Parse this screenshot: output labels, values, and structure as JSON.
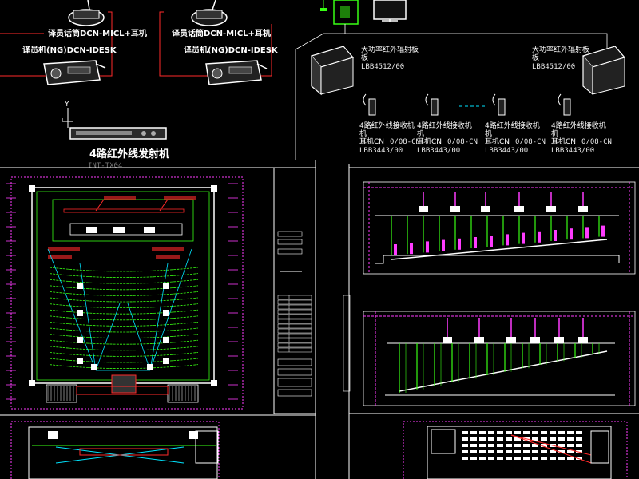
{
  "top_schematic": {
    "left_group": {
      "mic_label_1": "译员话筒DCN-MICL+耳机",
      "desk_label_1": "译员机(NG)DCN-IDESK",
      "transmitter_label": "4路红外线发射机",
      "transmitter_code": "INT-TX04",
      "antenna_label": "Y"
    },
    "right_group": {
      "mic_label_2": "译员话筒DCN-MICL+耳机",
      "desk_label_2": "译员机(NG)DCN-IDESK"
    },
    "radiators": [
      {
        "name": "大功率红外辐射板",
        "code": "LBB4512/00"
      },
      {
        "name": "大功率红外辐射板",
        "code": "LBB4512/00"
      }
    ],
    "receivers": [
      {
        "name": "4路红外线接收机",
        "extra": "耳机CN",
        "code1": "LBB3443/00"
      },
      {
        "name": "4路红外线接收机",
        "extra": "耳机CN",
        "code1": "LBB3443/00"
      },
      {
        "name": "4路红外线接收机",
        "extra": "耳机CN",
        "code1": "LBB3443/00"
      },
      {
        "name": "4路红外线接收机",
        "extra": "耳机CN",
        "code1": "LBB3443/00"
      }
    ],
    "receiver_code_prefix": "0/08-CN"
  },
  "colors": {
    "background": "#000000",
    "red": "#ff2a2a",
    "green": "#39ff14",
    "cyan": "#00e5ff",
    "magenta": "#ff3cff",
    "yellow": "#ffe600",
    "white": "#ffffff",
    "gray": "#9a9a9a"
  }
}
